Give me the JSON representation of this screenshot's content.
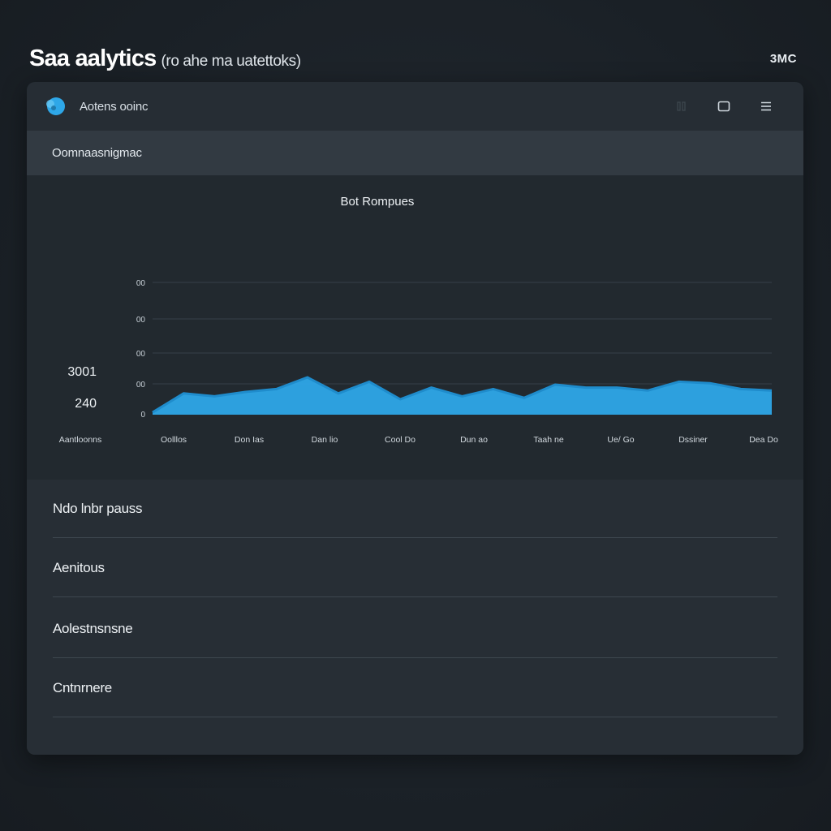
{
  "header": {
    "title": "Saa aalytics",
    "subtitle": "(ro ahe ma uatettoks)",
    "top_right": "3MC"
  },
  "toolbar": {
    "app_name": "Aotens ooinc",
    "icons": [
      "app-logo-icon",
      "grid-icon",
      "window-icon",
      "menu-icon"
    ]
  },
  "section": {
    "title": "Oomnaasnigmac"
  },
  "chart_data": {
    "type": "area",
    "title": "Bot Rompues",
    "categories": [
      "Aantloonns",
      "Oolllos",
      "Don Ias",
      "Dan lio",
      "Cool Do",
      "Dun ao",
      "Taah ne",
      "Ue/ Go",
      "Dssiner",
      "Dea Do"
    ],
    "y_ticks": [
      "0",
      "00",
      "00",
      "00",
      "00"
    ],
    "side_labels": [
      "3001",
      "240"
    ],
    "x": [
      0,
      0.5,
      1,
      1.5,
      2,
      2.5,
      3,
      3.5,
      4,
      4.5,
      5,
      5.5,
      6,
      6.5,
      7,
      7.5,
      8,
      8.5,
      9,
      9.5,
      10
    ],
    "values": [
      1,
      14,
      12,
      15,
      17,
      25,
      14,
      22,
      10,
      18,
      12,
      17,
      11,
      20,
      18,
      18,
      16,
      22,
      21,
      17,
      16
    ],
    "ylim": [
      0,
      90
    ],
    "grid": true,
    "color": "#2ea7e8"
  },
  "list": {
    "items": [
      "Ndo lnbr pauss",
      "Aenitous",
      "Aolestnsnsne",
      "Cntnrnere"
    ]
  },
  "colors": {
    "accent": "#2ea7e8",
    "panel": "#262d34",
    "background": "#1b2127"
  }
}
